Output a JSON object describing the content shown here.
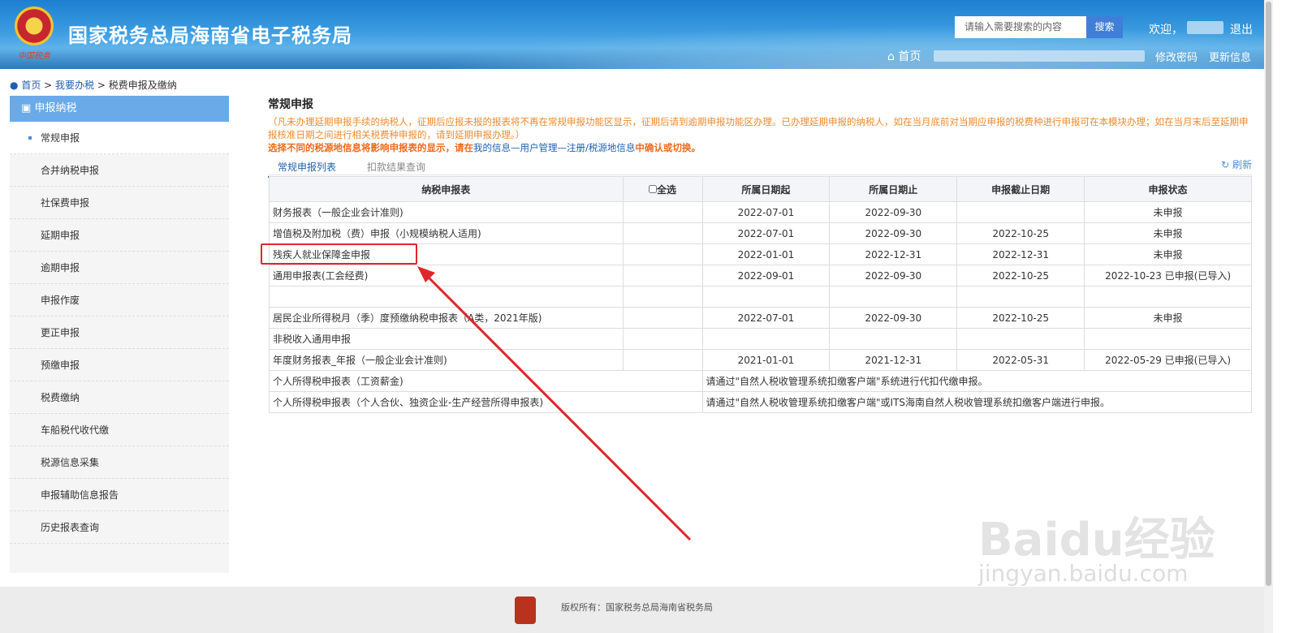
{
  "header": {
    "title": "国家税务总局海南省电子税务局",
    "logo_text": "中国税务",
    "search_placeholder": "请输入需要搜索的内容",
    "search_btn": "搜索",
    "welcome": "欢迎，",
    "logout": "退出",
    "home": "首页",
    "change_pw": "修改密码",
    "update_info": "更新信息"
  },
  "breadcrumb": [
    "首页",
    ">",
    "我要办税",
    ">",
    "税费申报及缴纳"
  ],
  "sidebar": {
    "header": "申报纳税",
    "items": [
      "常规申报",
      "合并纳税申报",
      "社保费申报",
      "延期申报",
      "逾期申报",
      "申报作废",
      "更正申报",
      "预缴申报",
      "税费缴纳",
      "车船税代收代缴",
      "税源信息采集",
      "申报辅助信息报告",
      "历史报表查询"
    ]
  },
  "main": {
    "title": "常规申报",
    "note": "（凡未办理延期申报手续的纳税人，征期后应报未报的报表将不再在常规申报功能区显示，征期后请到逾期申报功能区办理。已办理延期申报的纳税人，如在当月底前对当期应申报的税费种进行申报可在本模块办理；如在当月末后至延期申报核准日期之间进行相关税费种申报的，请到延期申报办理。）",
    "warn_a": "选择不同的税源地信息将影响申报表的显示，请在",
    "warn_link": "我的信息—用户管理—注册/税源地信息",
    "warn_b": "中确认或切换。",
    "tabs": [
      "常规申报列表",
      "扣款结果查询"
    ],
    "refresh": "刷新",
    "columns": [
      "纳税申报表",
      "全选",
      "所属日期起",
      "所属日期止",
      "申报截止日期",
      "申报状态"
    ],
    "rows": [
      [
        "财务报表（一般企业会计准则)",
        "",
        "2022-07-01",
        "2022-09-30",
        "",
        "未申报"
      ],
      [
        "增值税及附加税（费）申报（小规模纳税人适用)",
        "",
        "2022-07-01",
        "2022-09-30",
        "2022-10-25",
        "未申报"
      ],
      [
        "残疾人就业保障金申报",
        "",
        "2022-01-01",
        "2022-12-31",
        "2022-12-31",
        "未申报"
      ],
      [
        "通用申报表(工会经费)",
        "",
        "2022-09-01",
        "2022-09-30",
        "2022-10-25",
        "2022-10-23 已申报(已导入)"
      ],
      [
        "",
        "",
        "",
        "",
        "",
        ""
      ],
      [
        "居民企业所得税月（季）度预缴纳税申报表（A类，2021年版)",
        "",
        "2022-07-01",
        "2022-09-30",
        "2022-10-25",
        "未申报"
      ],
      [
        "非税收入通用申报",
        "",
        "",
        "",
        "",
        ""
      ],
      [
        "年度财务报表_年报（一般企业会计准则)",
        "",
        "2021-01-01",
        "2021-12-31",
        "2022-05-31",
        "2022-05-29 已申报(已导入)"
      ]
    ],
    "span_rows": [
      [
        "个人所得税申报表（工资薪金)",
        "请通过\"自然人税收管理系统扣缴客户端\"系统进行代扣代缴申报。"
      ],
      [
        "个人所得税申报表（个人合伙、独资企业-生产经营所得申报表)",
        "请通过\"自然人税收管理系统扣缴客户端\"或ITS海南自然人税收管理系统扣缴客户端进行申报。"
      ]
    ]
  },
  "footer": {
    "copyright": "版权所有：国家税务总局海南省税务局"
  },
  "watermark": {
    "brand": "Baidu经验",
    "url": "jingyan.baidu.com"
  }
}
